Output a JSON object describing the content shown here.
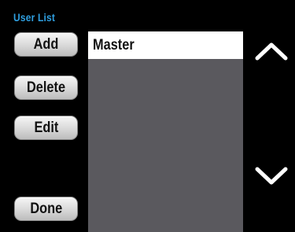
{
  "header": {
    "title": "User List"
  },
  "buttons": {
    "add": "Add",
    "delete": "Delete",
    "edit": "Edit",
    "done": "Done"
  },
  "users": [
    {
      "name": "Master",
      "selected": true
    }
  ],
  "colors": {
    "title": "#2f9fe0",
    "list_background": "#5a595e",
    "selected_row": "#ffffff",
    "arrows": "#ffffff"
  },
  "icons": {
    "scroll_up": "chevron-up-icon",
    "scroll_down": "chevron-down-icon"
  }
}
